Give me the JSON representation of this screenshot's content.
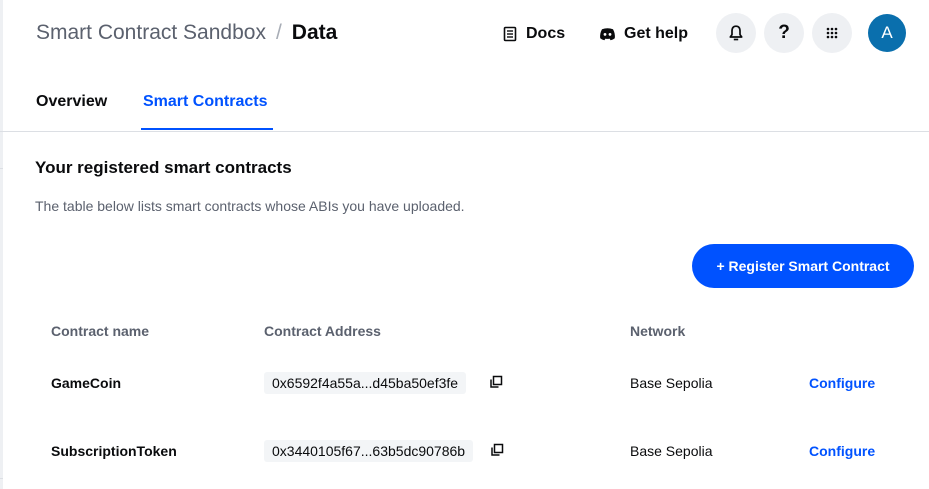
{
  "header": {
    "breadcrumb_root": "Smart Contract Sandbox",
    "breadcrumb_separator": "/",
    "breadcrumb_current": "Data",
    "docs_label": "Docs",
    "docs_icon": "document-icon",
    "help_label": "Get help",
    "help_icon": "discord-icon",
    "notifications_icon": "bell-icon",
    "help_button_glyph": "?",
    "apps_icon": "grid-icon",
    "avatar_initial": "A"
  },
  "tabs": [
    {
      "label": "Overview",
      "active": false
    },
    {
      "label": "Smart Contracts",
      "active": true
    }
  ],
  "content": {
    "title": "Your registered smart contracts",
    "description": "The table below lists smart contracts whose ABIs you have uploaded.",
    "register_button_label": "+ Register Smart Contract"
  },
  "table": {
    "columns": [
      "Contract name",
      "Contract Address",
      "Network"
    ],
    "rows": [
      {
        "name": "GameCoin",
        "address": "0x6592f4a55a...d45ba50ef3fe",
        "network": "Base Sepolia",
        "action": "Configure"
      },
      {
        "name": "SubscriptionToken",
        "address": "0x3440105f67...63b5dc90786b",
        "network": "Base Sepolia",
        "action": "Configure"
      }
    ]
  },
  "colors": {
    "accent": "#0052ff",
    "avatar": "#0a6fad",
    "muted_text": "#5b616e",
    "button_bg": "#eef0f3"
  }
}
